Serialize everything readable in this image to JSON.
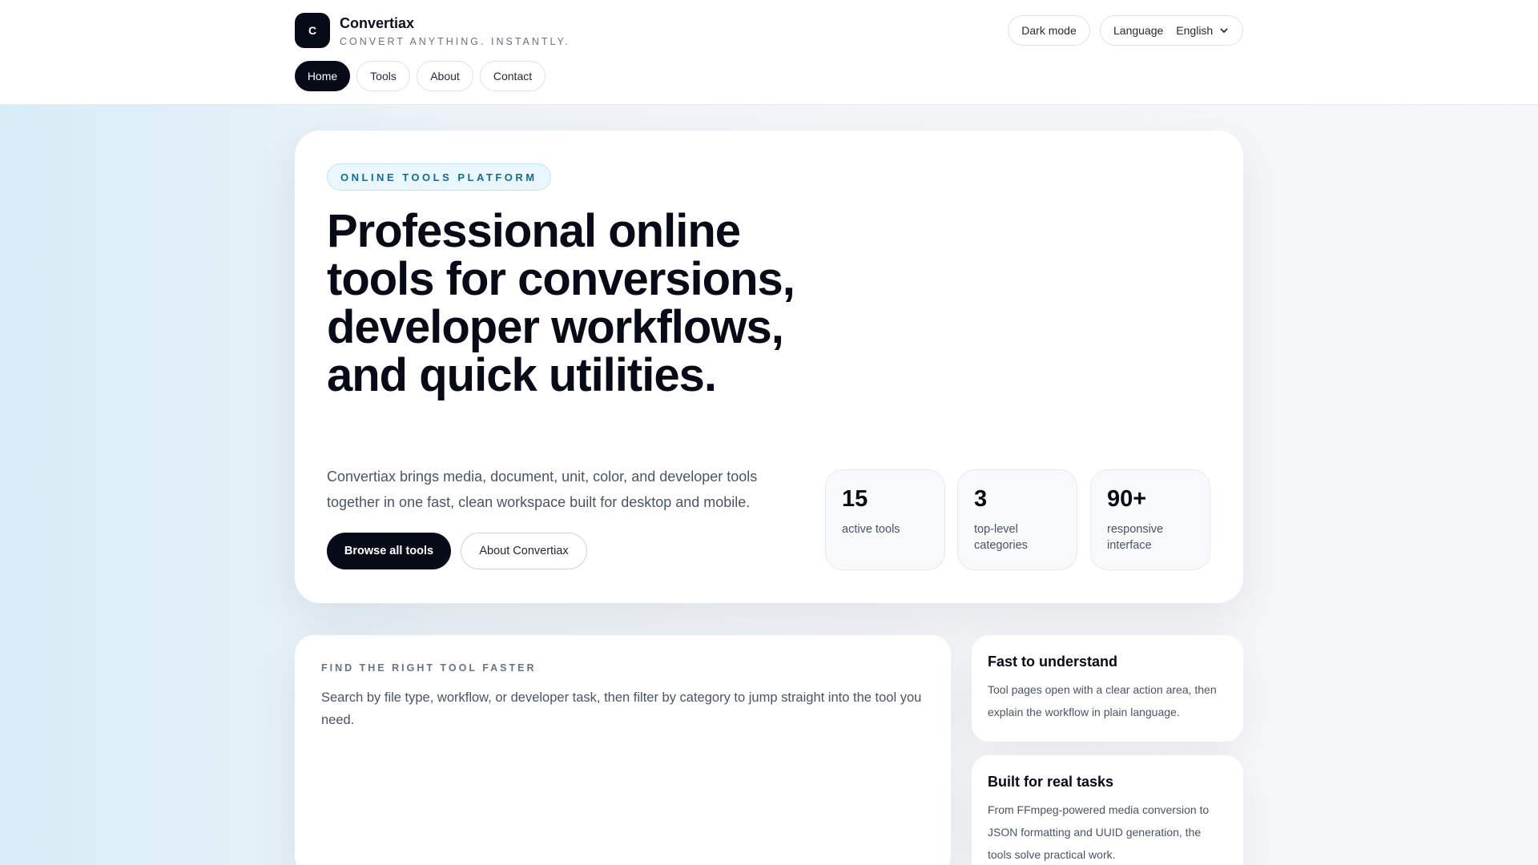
{
  "brand": {
    "logo_letter": "C",
    "name": "Convertiax",
    "tagline": "CONVERT ANYTHING. INSTANTLY."
  },
  "header": {
    "dark_mode_label": "Dark mode",
    "language_label": "Language",
    "language_value": "English"
  },
  "nav": {
    "items": [
      {
        "label": "Home",
        "active": true
      },
      {
        "label": "Tools",
        "active": false
      },
      {
        "label": "About",
        "active": false
      },
      {
        "label": "Contact",
        "active": false
      }
    ]
  },
  "hero": {
    "eyebrow": "ONLINE TOOLS PLATFORM",
    "title": "Professional online tools for conversions, developer workflows, and quick utilities.",
    "description": "Convertiax brings media, document, unit, color, and developer tools together in one fast, clean workspace built for desktop and mobile.",
    "primary_cta": "Browse all tools",
    "secondary_cta": "About Convertiax",
    "stats": [
      {
        "value": "15",
        "label": "active tools"
      },
      {
        "value": "3",
        "label": "top-level categories"
      },
      {
        "value": "90+",
        "label": "responsive interface"
      }
    ]
  },
  "find": {
    "eyebrow": "FIND THE RIGHT TOOL FASTER",
    "description": "Search by file type, workflow, or developer task, then filter by category to jump straight into the tool you need."
  },
  "features": [
    {
      "title": "Fast to understand",
      "text": "Tool pages open with a clear action area, then explain the workflow in plain language."
    },
    {
      "title": "Built for real tasks",
      "text": "From FFmpeg-powered media conversion to JSON formatting and UUID generation, the tools solve practical work."
    }
  ],
  "colors": {
    "primary": "#070b18",
    "accent": "#0f6d99",
    "accent_bg": "#eaf6fd"
  }
}
